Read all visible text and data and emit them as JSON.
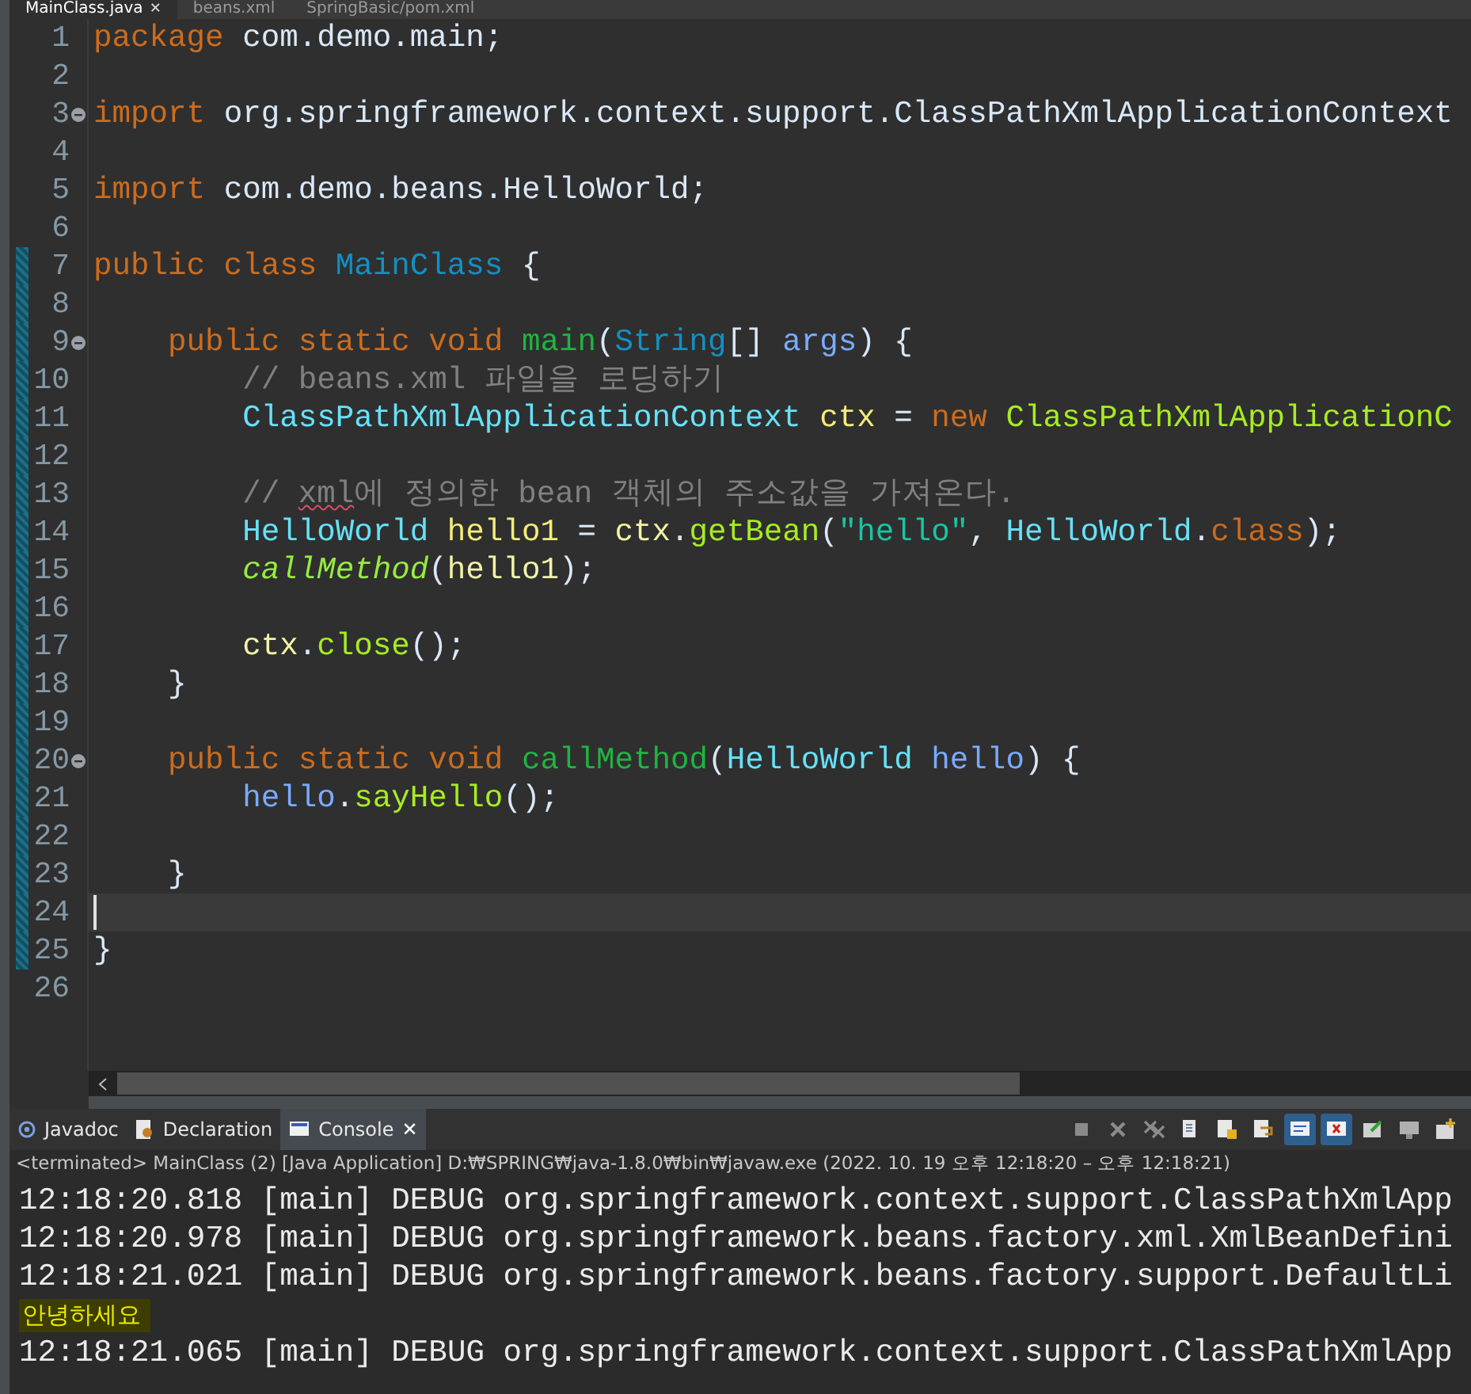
{
  "editor_tabs": [
    {
      "label": "MainClass.java",
      "selected": true
    },
    {
      "label": "beans.xml",
      "selected": false
    },
    {
      "label": "SpringBasic/pom.xml",
      "selected": false
    }
  ],
  "editor": {
    "lines": [
      {
        "number": "1",
        "changed": false,
        "tokens": [
          {
            "text": "package ",
            "kind": "keyword"
          },
          {
            "text": "com.demo.main;",
            "kind": "plain"
          }
        ]
      },
      {
        "number": "2",
        "changed": false
      },
      {
        "number": "3",
        "changed": false,
        "foldable": true,
        "tokens": [
          {
            "text": "import ",
            "kind": "keyword"
          },
          {
            "text": "org.springframework.context.support.ClassPathXmlApplicationContext",
            "kind": "plain"
          }
        ]
      },
      {
        "number": "4",
        "changed": false
      },
      {
        "number": "5",
        "changed": false,
        "tokens": [
          {
            "text": "import ",
            "kind": "keyword"
          },
          {
            "text": "com.demo.beans.HelloWorld;",
            "kind": "plain"
          }
        ]
      },
      {
        "number": "6",
        "changed": false
      },
      {
        "number": "7",
        "changed": true,
        "tokens": [
          {
            "text": "public class ",
            "kind": "keyword"
          },
          {
            "text": "MainClass",
            "kind": "class"
          },
          {
            "text": " {",
            "kind": "plain"
          }
        ]
      },
      {
        "number": "8",
        "changed": true
      },
      {
        "number": "9",
        "changed": true,
        "foldable": true,
        "tokens": [
          {
            "text": "    public static void ",
            "kind": "keyword"
          },
          {
            "text": "main",
            "kind": "declaration"
          },
          {
            "text": "(",
            "kind": "plain"
          },
          {
            "text": "String",
            "kind": "class"
          },
          {
            "text": "[] ",
            "kind": "plain"
          },
          {
            "text": "args",
            "kind": "param"
          },
          {
            "text": ") {",
            "kind": "plain"
          }
        ]
      },
      {
        "number": "10",
        "changed": true,
        "tokens": [
          {
            "text": "        // beans.xml 파일을 로딩하기",
            "kind": "comment"
          }
        ]
      },
      {
        "number": "11",
        "changed": true,
        "tokens": [
          {
            "text": "        ClassPathXmlApplicationContext ",
            "kind": "type"
          },
          {
            "text": "ctx",
            "kind": "variable"
          },
          {
            "text": " = ",
            "kind": "plain"
          },
          {
            "text": "new ",
            "kind": "keyword"
          },
          {
            "text": "ClassPathXmlApplicationC",
            "kind": "method"
          }
        ]
      },
      {
        "number": "12",
        "changed": true
      },
      {
        "number": "13",
        "changed": true,
        "tokens": [
          {
            "text": "        // ",
            "kind": "comment"
          },
          {
            "text": "xml",
            "kind": "flagged"
          },
          {
            "text": "에 정의한 bean 객체의 주소값을 가져온다.",
            "kind": "comment"
          }
        ]
      },
      {
        "number": "14",
        "changed": true,
        "tokens": [
          {
            "text": "        HelloWorld ",
            "kind": "type"
          },
          {
            "text": "hello1",
            "kind": "variable"
          },
          {
            "text": " = ",
            "kind": "plain"
          },
          {
            "text": "ctx",
            "kind": "variable_use"
          },
          {
            "text": ".",
            "kind": "plain"
          },
          {
            "text": "getBean",
            "kind": "method"
          },
          {
            "text": "(",
            "kind": "plain"
          },
          {
            "text": "\"hello\"",
            "kind": "string"
          },
          {
            "text": ", ",
            "kind": "plain"
          },
          {
            "text": "HelloWorld",
            "kind": "type"
          },
          {
            "text": ".",
            "kind": "plain"
          },
          {
            "text": "class",
            "kind": "keyword"
          },
          {
            "text": ");",
            "kind": "plain"
          }
        ]
      },
      {
        "number": "15",
        "changed": true,
        "tokens": [
          {
            "text": "        callMethod",
            "kind": "static_method"
          },
          {
            "text": "(",
            "kind": "plain"
          },
          {
            "text": "hello1",
            "kind": "variable_use"
          },
          {
            "text": ");",
            "kind": "plain"
          }
        ]
      },
      {
        "number": "16",
        "changed": true
      },
      {
        "number": "17",
        "changed": true,
        "tokens": [
          {
            "text": "        ctx",
            "kind": "variable_use"
          },
          {
            "text": ".",
            "kind": "plain"
          },
          {
            "text": "close",
            "kind": "method"
          },
          {
            "text": "();",
            "kind": "plain"
          }
        ]
      },
      {
        "number": "18",
        "changed": true,
        "tokens": [
          {
            "text": "    }",
            "kind": "plain"
          }
        ]
      },
      {
        "number": "19",
        "changed": true
      },
      {
        "number": "20",
        "changed": true,
        "foldable": true,
        "tokens": [
          {
            "text": "    public static void ",
            "kind": "keyword"
          },
          {
            "text": "callMethod",
            "kind": "declaration"
          },
          {
            "text": "(",
            "kind": "plain"
          },
          {
            "text": "HelloWorld ",
            "kind": "type"
          },
          {
            "text": "hello",
            "kind": "param"
          },
          {
            "text": ") {",
            "kind": "plain"
          }
        ]
      },
      {
        "number": "21",
        "changed": true,
        "tokens": [
          {
            "text": "        hello",
            "kind": "param"
          },
          {
            "text": ".",
            "kind": "plain"
          },
          {
            "text": "sayHello",
            "kind": "method"
          },
          {
            "text": "();",
            "kind": "plain"
          }
        ]
      },
      {
        "number": "22",
        "changed": true
      },
      {
        "number": "23",
        "changed": true,
        "tokens": [
          {
            "text": "    }",
            "kind": "plain"
          }
        ]
      },
      {
        "number": "24",
        "changed": true,
        "current": true
      },
      {
        "number": "25",
        "changed": true,
        "tokens": [
          {
            "text": "}",
            "kind": "plain"
          }
        ]
      },
      {
        "number": "26",
        "changed": false
      }
    ]
  },
  "panel_tabs": [
    {
      "label": "Javadoc",
      "selected": false
    },
    {
      "label": "Declaration",
      "selected": false
    },
    {
      "label": "Console",
      "selected": true
    }
  ],
  "close_glyph": "✕",
  "toolbar": [
    {
      "kind": "stop",
      "selected": false
    },
    {
      "kind": "remove",
      "selected": false
    },
    {
      "kind": "remove_all",
      "selected": false
    },
    {
      "kind": "clear",
      "selected": false
    },
    {
      "kind": "scroll_lock",
      "selected": false
    },
    {
      "kind": "word_wrap",
      "selected": false
    },
    {
      "kind": "show_out",
      "selected": true
    },
    {
      "kind": "show_err",
      "selected": true
    },
    {
      "kind": "pin",
      "selected": false
    },
    {
      "kind": "display",
      "selected": false
    },
    {
      "kind": "new_console",
      "selected": false
    }
  ],
  "console": {
    "status": "<terminated> MainClass (2) [Java Application] D:₩SPRING₩java-1.8.0₩bin₩javaw.exe  (2022. 10. 19 오후 12:18:20 – 오후 12:18:21)",
    "lines": [
      {
        "kind": "log",
        "text": "12:18:20.818 [main] DEBUG org.springframework.context.support.ClassPathXmlApp"
      },
      {
        "kind": "log",
        "text": "12:18:20.978 [main] DEBUG org.springframework.beans.factory.xml.XmlBeanDefini"
      },
      {
        "kind": "log",
        "text": "12:18:21.021 [main] DEBUG org.springframework.beans.factory.support.DefaultLi"
      },
      {
        "kind": "output",
        "text": "안녕하세요"
      },
      {
        "kind": "log",
        "text": "12:18:21.065 [main] DEBUG org.springframework.context.support.ClassPathXmlApp"
      }
    ]
  }
}
